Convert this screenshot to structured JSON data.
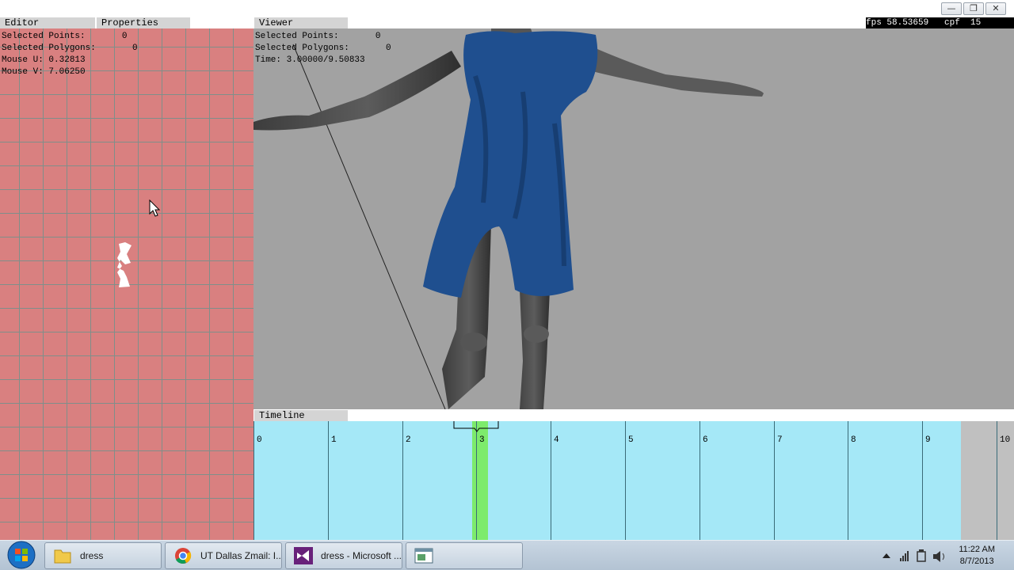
{
  "window_controls": {
    "minimize": "—",
    "restore": "❐",
    "close": "✕"
  },
  "status_overlay": "fps 58.53659   cpf  15",
  "panels": {
    "editor_tab": "Editor",
    "properties_tab": "Properties",
    "viewer_tab": "Viewer",
    "timeline_tab": "Timeline"
  },
  "editor": {
    "selected_points": "Selected Points:       0",
    "selected_polygons": "Selected Polygons:       0",
    "mouse_u": "Mouse U: 0.32813",
    "mouse_v": "Mouse V: 7.06250"
  },
  "viewer": {
    "selected_points": "Selected Points:       0",
    "selected_polygons": "Selected Polygons:       0",
    "time": "Time: 3.00000/9.50833"
  },
  "timeline": {
    "ticks": [
      "0",
      "1",
      "2",
      "3",
      "4",
      "5",
      "6",
      "7",
      "8",
      "9",
      "10"
    ],
    "current_frame": 3,
    "end_time": 9.50833,
    "colors": {
      "track": "#a5e8f7",
      "current": "#7deb6c",
      "out_of_range": "#c0c0c0"
    }
  },
  "taskbar": {
    "items": [
      {
        "label": "dress",
        "icon": "folder-icon"
      },
      {
        "label": "UT Dallas Zmail: I...",
        "icon": "chrome-icon"
      },
      {
        "label": "dress - Microsoft ...",
        "icon": "visual-studio-icon"
      },
      {
        "label": "",
        "icon": "app-window-icon"
      }
    ],
    "time": "11:22 AM",
    "date": "8/7/2013"
  }
}
